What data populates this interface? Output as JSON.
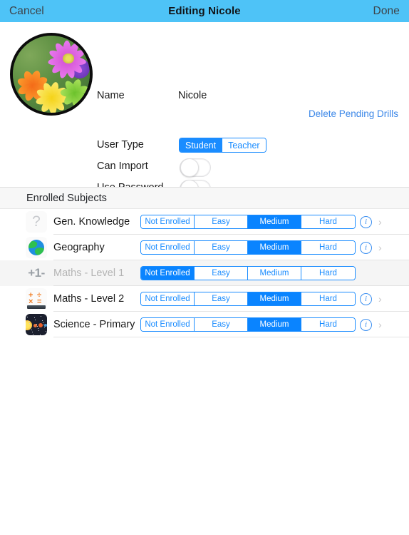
{
  "navbar": {
    "cancel_label": "Cancel",
    "title": "Editing Nicole",
    "done_label": "Done",
    "background_color": "#4ec3f7"
  },
  "profile": {
    "avatar_alt": "flower-photo-avatar",
    "name_label": "Name",
    "name_value": "Nicole",
    "delete_link_label": "Delete Pending Drills",
    "delete_link_color": "#3b87e8",
    "user_type": {
      "label": "User Type",
      "options": [
        "Student",
        "Teacher"
      ],
      "selected": "Student"
    },
    "can_import": {
      "label": "Can Import",
      "value": "off"
    },
    "use_password": {
      "label": "Use Password",
      "value": "off"
    }
  },
  "section": {
    "header": "Enrolled Subjects"
  },
  "level_options": [
    "Not Enrolled",
    "Easy",
    "Medium",
    "Hard"
  ],
  "accent_color": "#0a84ff",
  "subjects": [
    {
      "name": "Gen. Knowledge",
      "icon": "question-mark-icon",
      "selected_level": "Medium",
      "enabled": true,
      "has_info": true,
      "has_chevron": true
    },
    {
      "name": "Geography",
      "icon": "globe-icon",
      "selected_level": "Medium",
      "enabled": true,
      "has_info": true,
      "has_chevron": true
    },
    {
      "name": "Maths - Level 1",
      "icon": "plus-one-icon",
      "icon_text": "+1-",
      "selected_level": "Not Enrolled",
      "enabled": false,
      "has_info": false,
      "has_chevron": false
    },
    {
      "name": "Maths - Level 2",
      "icon": "math-symbols-icon",
      "selected_level": "Medium",
      "enabled": true,
      "has_info": true,
      "has_chevron": true
    },
    {
      "name": "Science - Primary",
      "icon": "solar-system-icon",
      "selected_level": "Medium",
      "enabled": true,
      "has_info": true,
      "has_chevron": true
    }
  ],
  "icons": {
    "info": "i",
    "chevron": "›",
    "question": "?"
  }
}
